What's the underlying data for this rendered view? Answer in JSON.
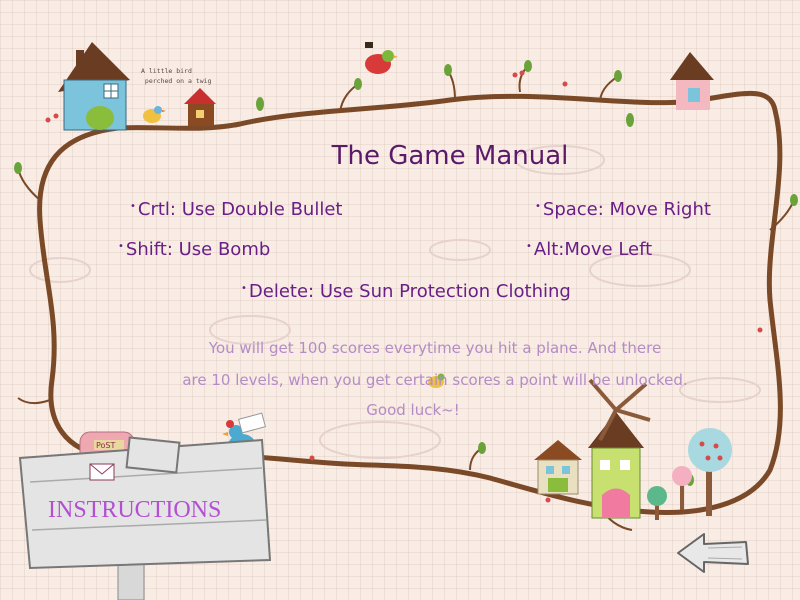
{
  "manual": {
    "title": "The Game Manual",
    "controls": [
      "Crtl: Use Double Bullet",
      "Space: Move Right",
      "Shift: Use Bomb",
      "Alt:Move Left",
      "Delete: Use Sun Protection Clothing"
    ],
    "description": [
      "You will get 100 scores everytime you hit a plane. And there",
      "are 10 levels, when you get certain scores a point will be unlocked.",
      "Good luck~!"
    ]
  },
  "sign": {
    "label": "INSTRUCTIONS",
    "post_text": "PoST"
  },
  "bird_note": "A little bird\n perched on a twig",
  "navigation": {
    "back_icon": "back-arrow-icon"
  },
  "colors": {
    "title": "#5a1a6a",
    "controls": "#6a1f86",
    "description": "#b58bc6",
    "sign_label": "#b24fd2",
    "vine": "#7a4a28"
  }
}
